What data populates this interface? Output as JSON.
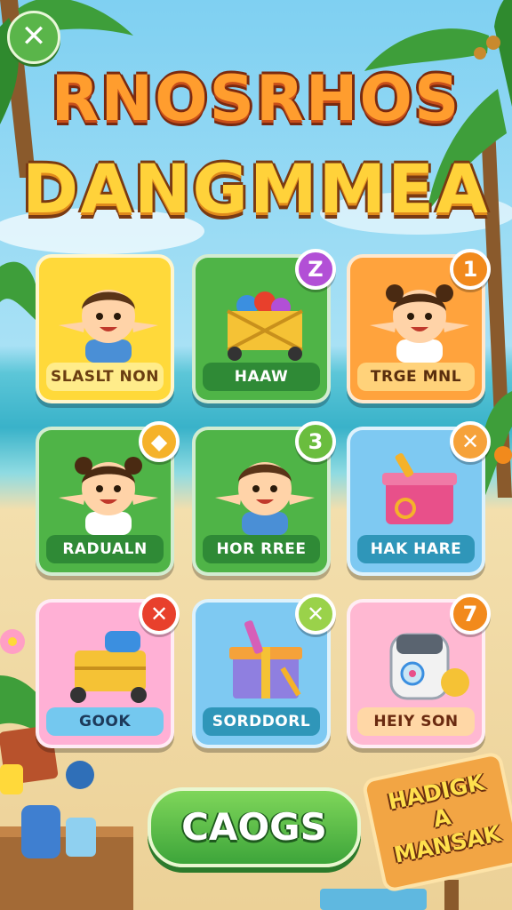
{
  "header": {
    "close_label": "✕",
    "title_line1": "RNOSRHOS",
    "title_line1_suffix": "S",
    "title_line2": "DANGMMEA"
  },
  "cards": [
    {
      "label": "SLASLT NON",
      "badge": "",
      "art": "boy",
      "color": "yellow"
    },
    {
      "label": "HAAW",
      "badge": "Z",
      "badge_color": "#b24fd6",
      "art": "fruit-crate",
      "color": "green"
    },
    {
      "label": "TRGE MNL",
      "badge": "1",
      "badge_color": "#f28a1c",
      "art": "girl",
      "color": "orange"
    },
    {
      "label": "RADUALN",
      "badge": "◆",
      "badge_color": "#f5b22a",
      "art": "girl",
      "color": "green"
    },
    {
      "label": "HOR RREE",
      "badge": "3",
      "badge_color": "#6abd3e",
      "art": "boy",
      "color": "green"
    },
    {
      "label": "HAK HARE",
      "badge": "✕",
      "badge_color": "#f6a23a",
      "art": "pink-box",
      "color": "blue"
    },
    {
      "label": "GOOK",
      "badge": "✕",
      "badge_color": "#e8402c",
      "art": "yellow-cart",
      "color": "pink"
    },
    {
      "label": "SORDDORL",
      "badge": "✕",
      "badge_color": "#9ad24a",
      "art": "gift-box",
      "color": "blue"
    },
    {
      "label": "HEIY SON",
      "badge": "7",
      "badge_color": "#f28a1c",
      "art": "robot",
      "color": "pink2"
    }
  ],
  "main_button": {
    "label": "CAOGS"
  },
  "sign": {
    "line1": "HADIGK",
    "line2": "A",
    "line3": "MANSAK"
  },
  "colors": {
    "accent_green": "#4fb447",
    "accent_orange": "#ffa33d",
    "accent_yellow": "#ffd93a"
  }
}
